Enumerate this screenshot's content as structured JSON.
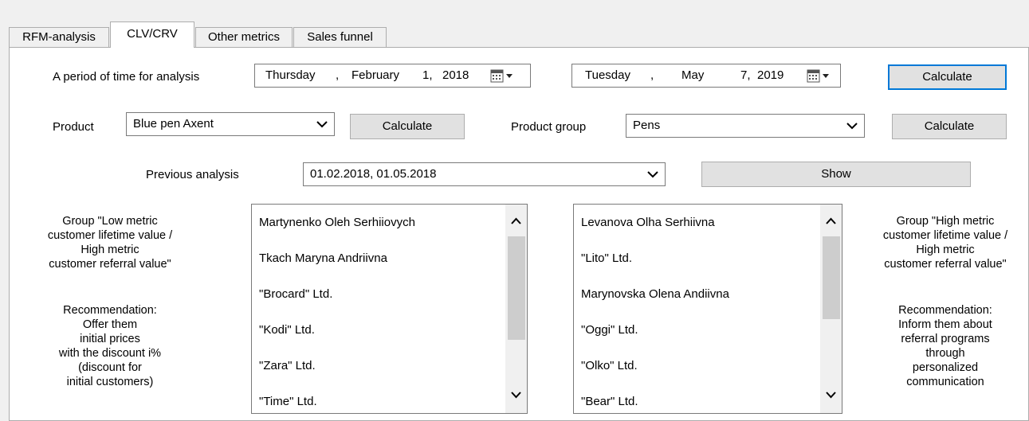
{
  "tabs": [
    {
      "label": "RFM-analysis",
      "active": false
    },
    {
      "label": "CLV/CRV",
      "active": true
    },
    {
      "label": "Other metrics",
      "active": false
    },
    {
      "label": "Sales funnel",
      "active": false
    }
  ],
  "period": {
    "label": "A period of time for analysis",
    "start": {
      "weekday": "Thursday",
      "sep": ",",
      "month": "February",
      "day": "1,",
      "year": "2018"
    },
    "end": {
      "weekday": "Tuesday",
      "sep": ",",
      "month": "May",
      "day": "7,",
      "year": "2019"
    },
    "calculate_label": "Calculate"
  },
  "product": {
    "label": "Product",
    "value": "Blue pen Axent",
    "calculate_label": "Calculate"
  },
  "product_group": {
    "label": "Product group",
    "value": "Pens",
    "calculate_label": "Calculate"
  },
  "previous": {
    "label": "Previous analysis",
    "value": "01.02.2018, 01.05.2018",
    "show_label": "Show"
  },
  "left_group": {
    "title_lines": [
      "Group \"Low metric",
      "customer lifetime value /",
      "High metric",
      "customer referral value\""
    ],
    "rec_lines": [
      "Recommendation:",
      "Offer them",
      "initial prices",
      "with the discount i%",
      "(discount for",
      "initial customers)"
    ],
    "items": [
      "Martynenko Oleh Serhiiovych",
      "Tkach Maryna Andriivna",
      "\"Brocard\" Ltd.",
      "\"Kodi\" Ltd.",
      "\"Zara\" Ltd.",
      "\"Time\" Ltd."
    ]
  },
  "right_group": {
    "title_lines": [
      "Group \"High metric",
      "customer lifetime value /",
      "High metric",
      "customer referral value\""
    ],
    "rec_lines": [
      "Recommendation:",
      "Inform them about",
      "referral programs",
      "through",
      "personalized",
      "communication"
    ],
    "items": [
      "Levanova Olha Serhiivna",
      "\"Lito\" Ltd.",
      "Marynovska Olena Andiivna",
      "\"Oggi\" Ltd.",
      "\"Olko\" Ltd.",
      "\"Bear\" Ltd."
    ]
  },
  "colors": {
    "accent": "#0078d7",
    "button": "#e1e1e1",
    "panel": "#ffffff",
    "window": "#f0f0f0"
  },
  "icons": [
    "calendar-icon",
    "dropdown-arrow-icon",
    "chevron-down-icon",
    "chevron-up-icon"
  ]
}
